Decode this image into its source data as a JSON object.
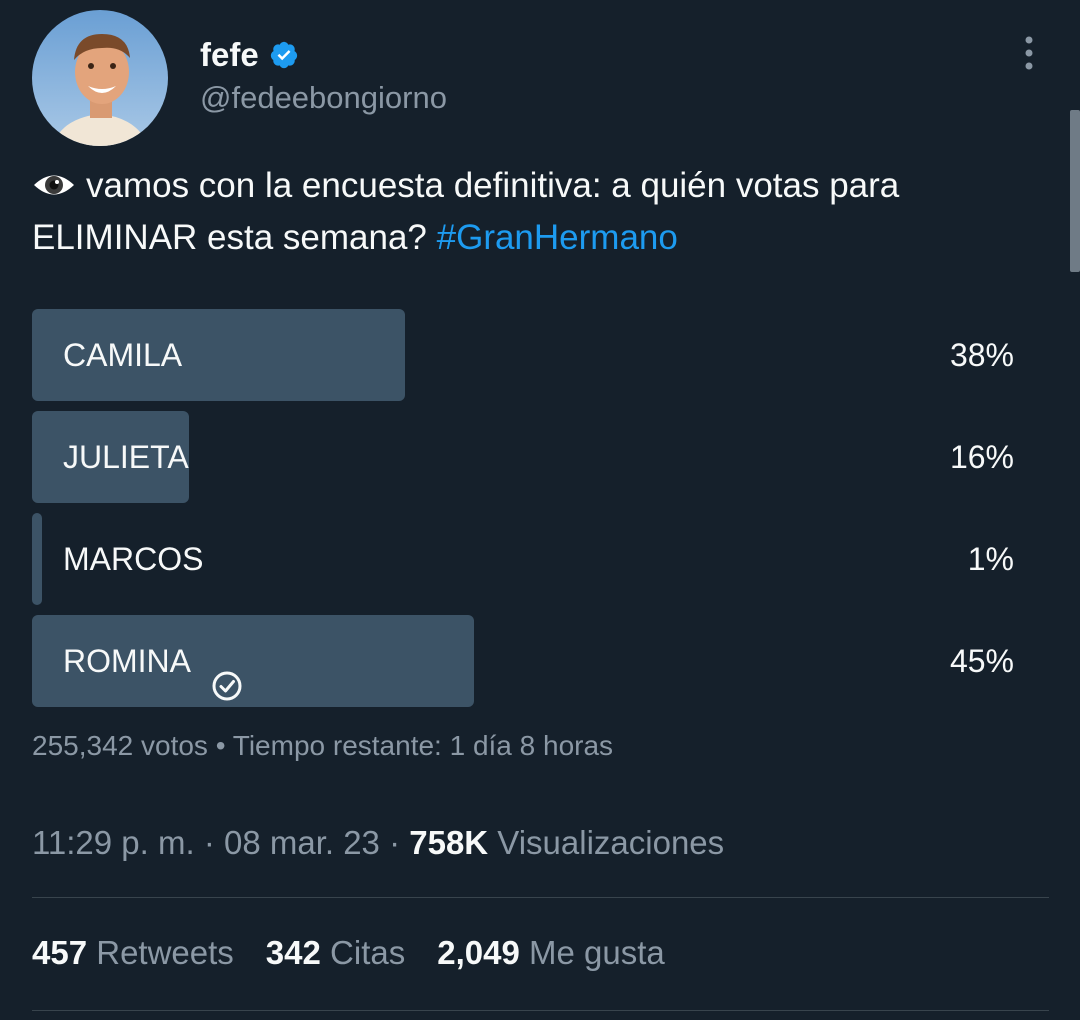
{
  "author": {
    "display_name": "fefe",
    "handle": "@fedeebongiorno",
    "verified": true
  },
  "icons": {
    "verified": "verified-badge-icon",
    "more": "more-vertical-icon",
    "eye_emoji": "eye-emoji-icon",
    "check": "check-circle-icon"
  },
  "tweet": {
    "text": "vamos con la encuesta definitiva: a quién votas para ELIMINAR esta semana? ",
    "hashtag": "#GranHermano"
  },
  "poll": {
    "options": [
      {
        "label": "CAMILA",
        "percent_text": "38%",
        "percent": 38,
        "selected": false
      },
      {
        "label": "JULIETA",
        "percent_text": "16%",
        "percent": 16,
        "selected": false
      },
      {
        "label": "MARCOS",
        "percent_text": "1%",
        "percent": 1,
        "selected": false
      },
      {
        "label": "ROMINA",
        "percent_text": "45%",
        "percent": 45,
        "selected": true
      }
    ],
    "meta": "255,342 votos • Tiempo restante: 1 día 8 horas"
  },
  "timestamp": {
    "time_date": "11:29 p. m. · 08 mar. 23 · ",
    "views_count": "758K",
    "views_label": " Visualizaciones"
  },
  "stats": {
    "retweets": {
      "count": "457",
      "label": " Retweets"
    },
    "quotes": {
      "count": "342",
      "label": " Citas"
    },
    "likes": {
      "count": "2,049",
      "label": " Me gusta"
    }
  },
  "colors": {
    "background": "#15202b",
    "poll_bar": "#3c5366",
    "accent": "#1d9bf0",
    "secondary_text": "#8b98a5"
  }
}
